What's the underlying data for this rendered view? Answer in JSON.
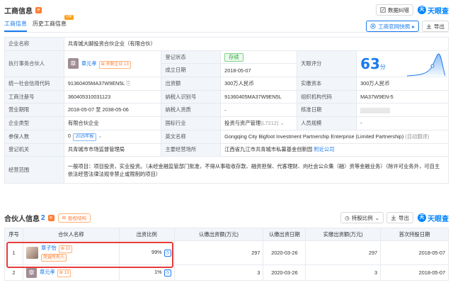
{
  "header": {
    "title": "工商信息",
    "badge": "e",
    "correction_btn": "数据纠错",
    "logo": "天眼查",
    "logo_glyph": "天"
  },
  "tabs": [
    {
      "label": "工商信息"
    },
    {
      "label": "历史工商信息",
      "vip": "VIP"
    }
  ],
  "toolbar": {
    "snapshot_btn": "工商官网快照",
    "export_btn": "导出"
  },
  "info": {
    "company_name": {
      "label": "企业名称",
      "value": "共青城大脚投资合伙企业（有限合伙）"
    },
    "partner": {
      "label": "执行事务合伙人",
      "avatar": "章",
      "name": "章元孝",
      "tag": "关联企业 13"
    },
    "status": {
      "label": "登记状态",
      "value": "存续"
    },
    "setup_date": {
      "label": "成立日期",
      "value": "2018-05-07"
    },
    "rating": {
      "label": "天眼评分",
      "score": "63",
      "unit": "分"
    },
    "credit_code": {
      "label": "统一社会信用代码",
      "value": "91360405MA37W9EN5L"
    },
    "capital": {
      "label": "出资额",
      "value": "300万人民币"
    },
    "paid_capital": {
      "label": "实缴资本",
      "value": "300万人民币"
    },
    "reg_no": {
      "label": "工商注册号",
      "value": "360405310031123"
    },
    "tax_no": {
      "label": "纳税人识别号",
      "value": "91360405MA37W9EN5L"
    },
    "org_code": {
      "label": "组织机构代码",
      "value": "MA37W9EN-5"
    },
    "term": {
      "label": "营业期限",
      "value": "2018-05-07 至 2038-05-06"
    },
    "tax_quality": {
      "label": "纳税人资质",
      "value": "-"
    },
    "approval_date": {
      "label": "核准日期",
      "value": ""
    },
    "type": {
      "label": "企业类型",
      "value": "有限合伙企业"
    },
    "industry": {
      "label": "国标行业",
      "value": "投资与资产管理",
      "code": "(L7212)"
    },
    "staff_size": {
      "label": "人员规模",
      "value": "-"
    },
    "insured": {
      "label": "参保人数",
      "value": "0",
      "tag": "2025年报"
    },
    "english_name": {
      "label": "英文名称",
      "value": "Gongqing City Bigfoot Investment Partnership Enterprise (Limited Partnership)",
      "note": "(自动翻译)"
    },
    "staff_count": {
      "value": "0人"
    },
    "authority": {
      "label": "登记机关",
      "value": "共青城市市场监督管理局"
    },
    "address": {
      "label": "主要经营场所",
      "value": "江西省九江市共青城市私募基金创新园",
      "link": "附近公司"
    },
    "scope": {
      "label": "经营范围",
      "value": "一般项目：项目投资，实业投资。（未经金融监管部门批准，不得从事吸收存款、融资担保、代客理财、向社会公众集（融）资等金融业务）（除许可业务外，可自主依法经营法律法规非禁止或限制的项目）"
    }
  },
  "partners": {
    "title": "合伙人信息",
    "count": "2",
    "structure_btn": "股权结构",
    "ratio_btn": "持股比例",
    "export_btn": "导出",
    "logo": "天眼查",
    "logo_glyph": "天",
    "columns": [
      "序号",
      "合伙人名称",
      "出资比例",
      "认缴出资额(万元)",
      "认缴出资日期",
      "实缴出资额(万元)",
      "实缴出资日期",
      "首次持股日期"
    ],
    "rows": [
      {
        "idx": "1",
        "name": "章子怡",
        "tag": "22",
        "beneficiary": "受益所有人",
        "ratio": "99%",
        "sub_amount": "297",
        "sub_date": "2020-03-26",
        "paid_amount": "297",
        "paid_date": "2020-03-26",
        "first_date": "2018-05-07"
      },
      {
        "idx": "2",
        "avatar": "章",
        "name": "章元孝",
        "tag": "13",
        "ratio": "1%",
        "sub_amount": "3",
        "sub_date": "2020-03-26",
        "paid_amount": "3",
        "paid_date": "2020-03-26",
        "first_date": "2018-05-07"
      }
    ]
  },
  "icons": [
    "correction-icon",
    "tianyancha-logo-icon",
    "snapshot-icon",
    "export-icon",
    "related-company-icon",
    "copy-icon",
    "structure-icon",
    "chevron-down-icon",
    "history-clock-icon"
  ],
  "colors": {
    "accent": "#1a7aee",
    "orange": "#ff7d32",
    "green": "#2a9f3a",
    "highlight": "#e63b3b"
  }
}
